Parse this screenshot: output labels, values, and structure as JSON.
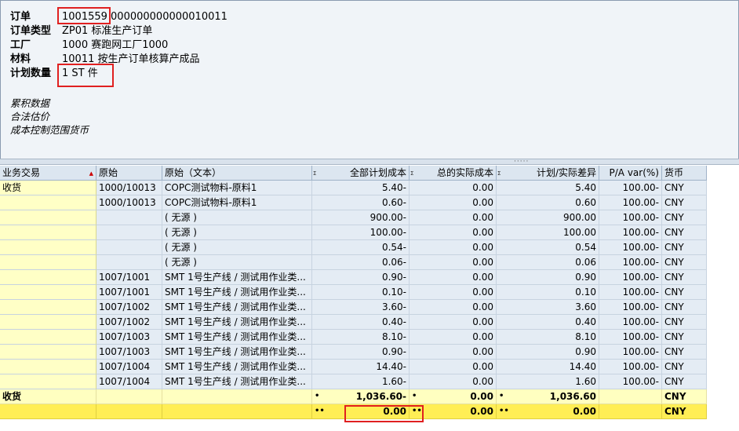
{
  "header": {
    "order_label": "订单",
    "order_value": "1001559 000000000000010011",
    "order_type_label": "订单类型",
    "order_type_value": "ZP01 标准生产订单",
    "plant_label": "工厂",
    "plant_value": "1000 赛跑网工厂1000",
    "material_label": "材料",
    "material_value": "10011 按生产订单核算产成品",
    "plan_qty_label": "计划数量",
    "plan_qty_value": "1 ST 件",
    "info1": "累积数据",
    "info2": "合法估价",
    "info3": "成本控制范围货币"
  },
  "grid": {
    "columns": [
      "业务交易",
      "原始",
      "原始（文本）",
      "全部计划成本",
      "总的实际成本",
      "计划/实际差异",
      "P/A var(%)",
      "货币"
    ],
    "rows": [
      {
        "txn": "收货",
        "origin": "1000/10013",
        "origin_text": "COPC测试物料-原料1",
        "plan": "5.40-",
        "actual": "0.00",
        "diff": "5.40",
        "pa": "100.00-",
        "cur": "CNY"
      },
      {
        "txn": "",
        "origin": "1000/10013",
        "origin_text": "COPC测试物料-原料1",
        "plan": "0.60-",
        "actual": "0.00",
        "diff": "0.60",
        "pa": "100.00-",
        "cur": "CNY"
      },
      {
        "txn": "",
        "origin": "",
        "origin_text": "( 无源 )",
        "plan": "900.00-",
        "actual": "0.00",
        "diff": "900.00",
        "pa": "100.00-",
        "cur": "CNY"
      },
      {
        "txn": "",
        "origin": "",
        "origin_text": "( 无源 )",
        "plan": "100.00-",
        "actual": "0.00",
        "diff": "100.00",
        "pa": "100.00-",
        "cur": "CNY"
      },
      {
        "txn": "",
        "origin": "",
        "origin_text": "( 无源 )",
        "plan": "0.54-",
        "actual": "0.00",
        "diff": "0.54",
        "pa": "100.00-",
        "cur": "CNY"
      },
      {
        "txn": "",
        "origin": "",
        "origin_text": "( 无源 )",
        "plan": "0.06-",
        "actual": "0.00",
        "diff": "0.06",
        "pa": "100.00-",
        "cur": "CNY"
      },
      {
        "txn": "",
        "origin": "1007/1001",
        "origin_text": "SMT 1号生产线 / 测试用作业类...",
        "plan": "0.90-",
        "actual": "0.00",
        "diff": "0.90",
        "pa": "100.00-",
        "cur": "CNY"
      },
      {
        "txn": "",
        "origin": "1007/1001",
        "origin_text": "SMT 1号生产线 / 测试用作业类...",
        "plan": "0.10-",
        "actual": "0.00",
        "diff": "0.10",
        "pa": "100.00-",
        "cur": "CNY"
      },
      {
        "txn": "",
        "origin": "1007/1002",
        "origin_text": "SMT 1号生产线 / 测试用作业类...",
        "plan": "3.60-",
        "actual": "0.00",
        "diff": "3.60",
        "pa": "100.00-",
        "cur": "CNY"
      },
      {
        "txn": "",
        "origin": "1007/1002",
        "origin_text": "SMT 1号生产线 / 测试用作业类...",
        "plan": "0.40-",
        "actual": "0.00",
        "diff": "0.40",
        "pa": "100.00-",
        "cur": "CNY"
      },
      {
        "txn": "",
        "origin": "1007/1003",
        "origin_text": "SMT 1号生产线 / 测试用作业类...",
        "plan": "8.10-",
        "actual": "0.00",
        "diff": "8.10",
        "pa": "100.00-",
        "cur": "CNY"
      },
      {
        "txn": "",
        "origin": "1007/1003",
        "origin_text": "SMT 1号生产线 / 测试用作业类...",
        "plan": "0.90-",
        "actual": "0.00",
        "diff": "0.90",
        "pa": "100.00-",
        "cur": "CNY"
      },
      {
        "txn": "",
        "origin": "1007/1004",
        "origin_text": "SMT 1号生产线 / 测试用作业类...",
        "plan": "14.40-",
        "actual": "0.00",
        "diff": "14.40",
        "pa": "100.00-",
        "cur": "CNY"
      },
      {
        "txn": "",
        "origin": "1007/1004",
        "origin_text": "SMT 1号生产线 / 测试用作业类...",
        "plan": "1.60-",
        "actual": "0.00",
        "diff": "1.60",
        "pa": "100.00-",
        "cur": "CNY"
      }
    ],
    "subtotal": {
      "txn": "收货",
      "plan": "1,036.60-",
      "actual": "0.00",
      "diff": "1,036.60",
      "cur": "CNY"
    },
    "grandtotal": {
      "plan": "0.00",
      "actual": "0.00",
      "diff": "0.00",
      "cur": "CNY"
    }
  },
  "colors": {
    "highlight_box": "#e02020",
    "grid_bg": "#e4ecf4",
    "key_col_bg": "#ffffc6",
    "total_bg": "#ffee55"
  }
}
